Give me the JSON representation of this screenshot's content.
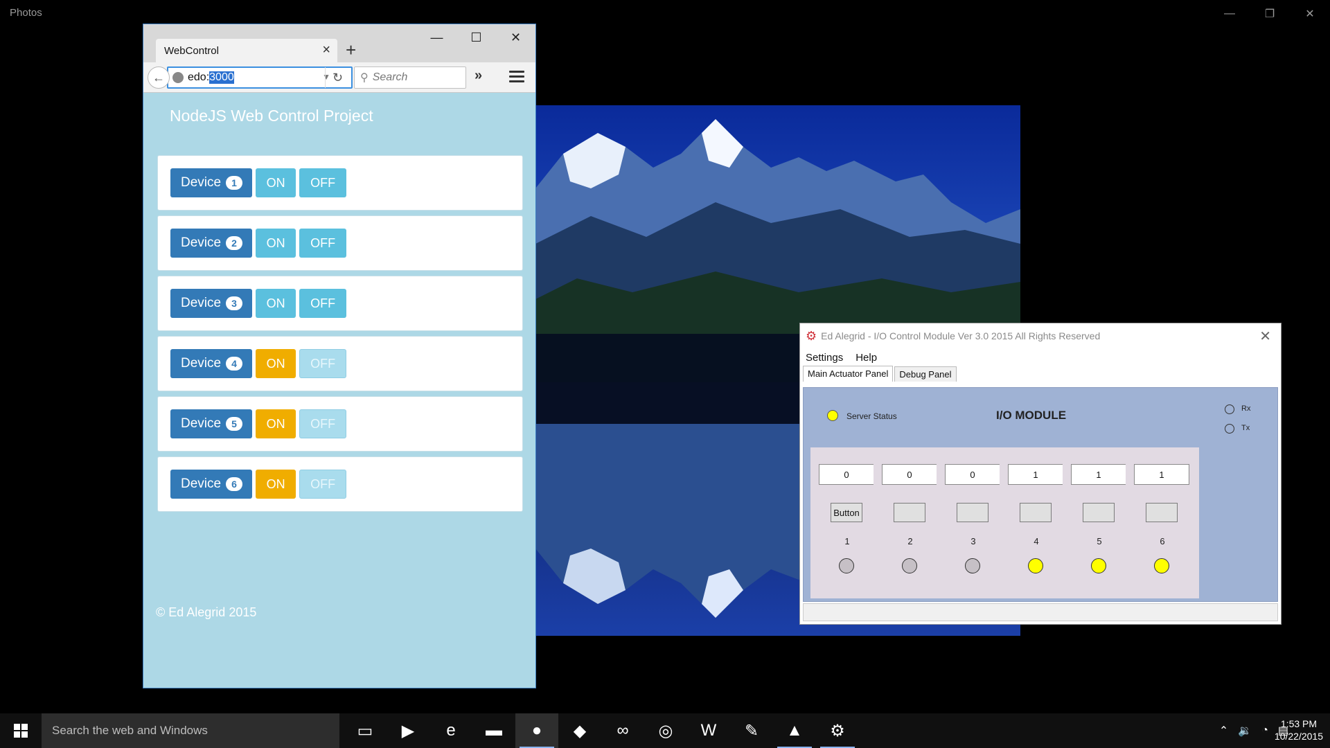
{
  "photos": {
    "title": "Photos",
    "minimize_glyph": "—",
    "restore_glyph": "❐",
    "close_glyph": "✕"
  },
  "browser": {
    "tab_title": "WebControl",
    "url_prefix": "edo:",
    "url_selected": "3000",
    "search_placeholder": "Search",
    "page_heading": "NodeJS Web Control Project",
    "on_label": "ON",
    "off_label": "OFF",
    "device_label": "Device",
    "devices": [
      {
        "number": "1",
        "state": "off"
      },
      {
        "number": "2",
        "state": "off"
      },
      {
        "number": "3",
        "state": "off"
      },
      {
        "number": "4",
        "state": "on"
      },
      {
        "number": "5",
        "state": "on"
      },
      {
        "number": "6",
        "state": "on"
      }
    ],
    "footer": "© Ed Alegrid 2015"
  },
  "io_module": {
    "window_title": "Ed Alegrid - I/O Control Module Ver 3.0 2015  All Rights Reserved",
    "menu": [
      "Settings",
      "Help"
    ],
    "tabs": [
      "Main Actuator Panel",
      "Debug Panel"
    ],
    "server_status_label": "Server Status",
    "heading": "I/O MODULE",
    "rx_label": "Rx",
    "tx_label": "Tx",
    "channels": [
      {
        "value": "0",
        "button": "Button",
        "number": "1",
        "led": "off"
      },
      {
        "value": "0",
        "button": "",
        "number": "2",
        "led": "off"
      },
      {
        "value": "0",
        "button": "",
        "number": "3",
        "led": "off"
      },
      {
        "value": "1",
        "button": "",
        "number": "4",
        "led": "on"
      },
      {
        "value": "1",
        "button": "",
        "number": "5",
        "led": "on"
      },
      {
        "value": "1",
        "button": "",
        "number": "6",
        "led": "on"
      }
    ],
    "colors": {
      "led_on": "#ffff00",
      "led_off": "#c6c0c6",
      "panel": "#9fb2d4"
    }
  },
  "taskbar": {
    "search_placeholder": "Search the web and Windows",
    "time": "1:53 PM",
    "date": "10/22/2015",
    "apps": [
      {
        "icon": "task-view-icon",
        "glyph": "▭"
      },
      {
        "icon": "powershell-icon",
        "glyph": "▶"
      },
      {
        "icon": "edge-icon",
        "glyph": "e"
      },
      {
        "icon": "file-explorer-icon",
        "glyph": "▬"
      },
      {
        "icon": "firefox-icon",
        "glyph": "●"
      },
      {
        "icon": "git-icon",
        "glyph": "◆"
      },
      {
        "icon": "visual-studio-icon",
        "glyph": "∞"
      },
      {
        "icon": "sql-server-icon",
        "glyph": "◎"
      },
      {
        "icon": "word-icon",
        "glyph": "W"
      },
      {
        "icon": "paint-icon",
        "glyph": "✎"
      },
      {
        "icon": "photos-icon",
        "glyph": "▲"
      },
      {
        "icon": "io-module-icon",
        "glyph": "⚙"
      }
    ]
  }
}
